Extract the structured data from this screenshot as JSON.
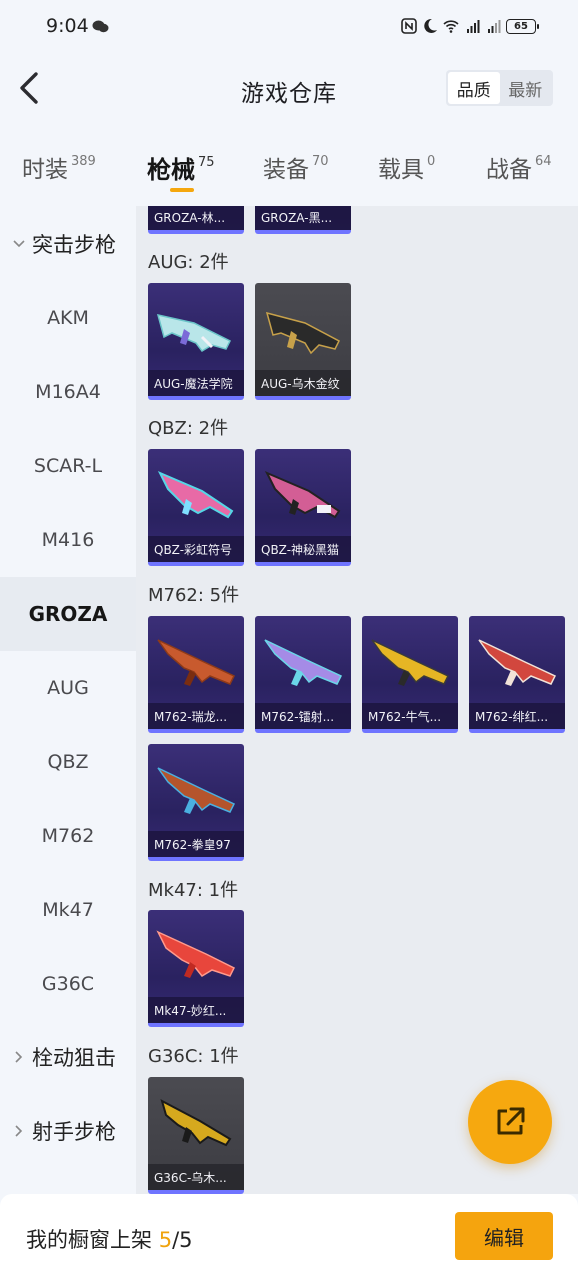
{
  "status_bar": {
    "time": "9:04",
    "battery": "65"
  },
  "header": {
    "title": "游戏仓库",
    "sort_options": [
      "品质",
      "最新"
    ]
  },
  "tabs": [
    {
      "label": "时装",
      "count": "389"
    },
    {
      "label": "枪械",
      "count": "75"
    },
    {
      "label": "装备",
      "count": "70"
    },
    {
      "label": "载具",
      "count": "0"
    },
    {
      "label": "战备",
      "count": "64"
    }
  ],
  "sidebar": {
    "groups": [
      "突击步枪",
      "栓动狙击",
      "射手步枪"
    ],
    "items": [
      "AKM",
      "M16A4",
      "SCAR-L",
      "M416",
      "GROZA",
      "AUG",
      "QBZ",
      "M762",
      "Mk47",
      "G36C"
    ]
  },
  "content": {
    "partial_cards": [
      "GROZA-林...",
      "GROZA-黑..."
    ],
    "groups": [
      {
        "label": "AUG: 2件",
        "items": [
          "AUG-魔法学院",
          "AUG-乌木金纹"
        ]
      },
      {
        "label": "QBZ: 2件",
        "items": [
          "QBZ-彩虹符号",
          "QBZ-神秘黑猫"
        ]
      },
      {
        "label": "M762: 5件",
        "items": [
          "M762-瑞龙...",
          "M762-镭射...",
          "M762-牛气...",
          "M762-绯红...",
          "M762-拳皇97"
        ]
      },
      {
        "label": "Mk47: 1件",
        "items": [
          "Mk47-妙红..."
        ]
      },
      {
        "label": "G36C: 1件",
        "items": [
          "G36C-乌木..."
        ]
      }
    ]
  },
  "bottom_bar": {
    "text": "我的橱窗上架",
    "count_current": "5",
    "count_total": "/5",
    "edit_label": "编辑"
  }
}
